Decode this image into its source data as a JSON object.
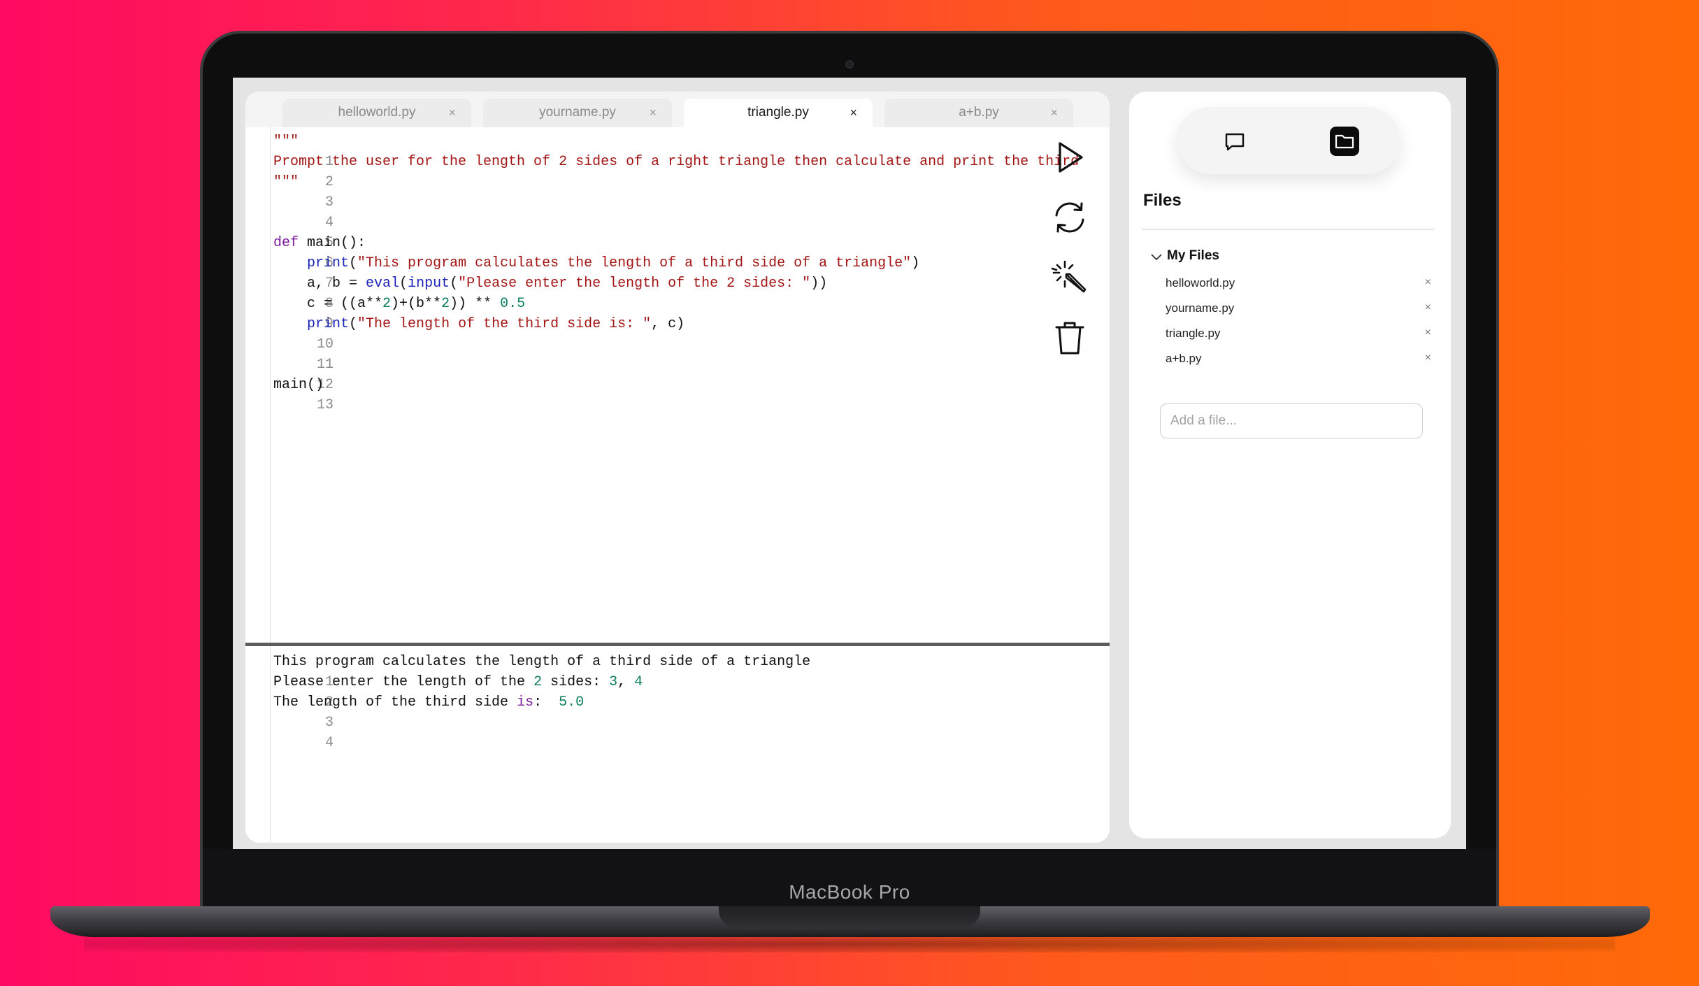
{
  "device": {
    "label": "MacBook Pro"
  },
  "tabs": [
    {
      "label": "helloworld.py",
      "close": "×"
    },
    {
      "label": "yourname.py",
      "close": "×"
    },
    {
      "label": "triangle.py",
      "close": "×"
    },
    {
      "label": "a+b.py",
      "close": "×"
    }
  ],
  "active_tab": "triangle.py",
  "editor": {
    "line_numbers": [
      "1",
      "2",
      "3",
      "4",
      "5",
      "6",
      "7",
      "8",
      "9",
      "10",
      "11",
      "12",
      "13"
    ],
    "lines": [
      "\"\"\"",
      "Prompt the user for the length of 2 sides of a right triangle then calculate and print the third",
      "\"\"\"",
      "",
      "",
      "def main():",
      "    print(\"This program calculates the length of a third side of a triangle\")",
      "    a, b = eval(input(\"Please enter the length of the 2 sides: \"))",
      "    c = ((a**2)+(b**2)) ** 0.5",
      "    print(\"The length of the third side is: \", c)",
      "",
      "",
      "main()"
    ]
  },
  "tools": {
    "run": "play-icon",
    "refresh": "refresh-icon",
    "magic": "magic-wand-icon",
    "delete": "trash-icon"
  },
  "console": {
    "line_numbers": [
      "1",
      "2",
      "3",
      "4"
    ],
    "lines": [
      "This program calculates the length of a third side of a triangle",
      "Please enter the length of the 2 sides: 3, 4",
      "The length of the third side is:  5.0",
      ""
    ]
  },
  "sidebar": {
    "switcher": {
      "chat_icon": "chat-bubble-icon",
      "files_icon": "folder-icon"
    },
    "title": "Files",
    "folder": "My Files",
    "files": [
      {
        "name": "helloworld.py",
        "close": "×"
      },
      {
        "name": "yourname.py",
        "close": "×"
      },
      {
        "name": "triangle.py",
        "close": "×"
      },
      {
        "name": "a+b.py",
        "close": "×"
      }
    ],
    "add_placeholder": "Add a file..."
  },
  "colors": {
    "string": "#a31515",
    "keyword": "#7a1e9c",
    "builtin": "#1c24b8",
    "number": "#0d7d5f",
    "background_gradient": [
      "#ff0a62",
      "#ff6a08"
    ]
  }
}
